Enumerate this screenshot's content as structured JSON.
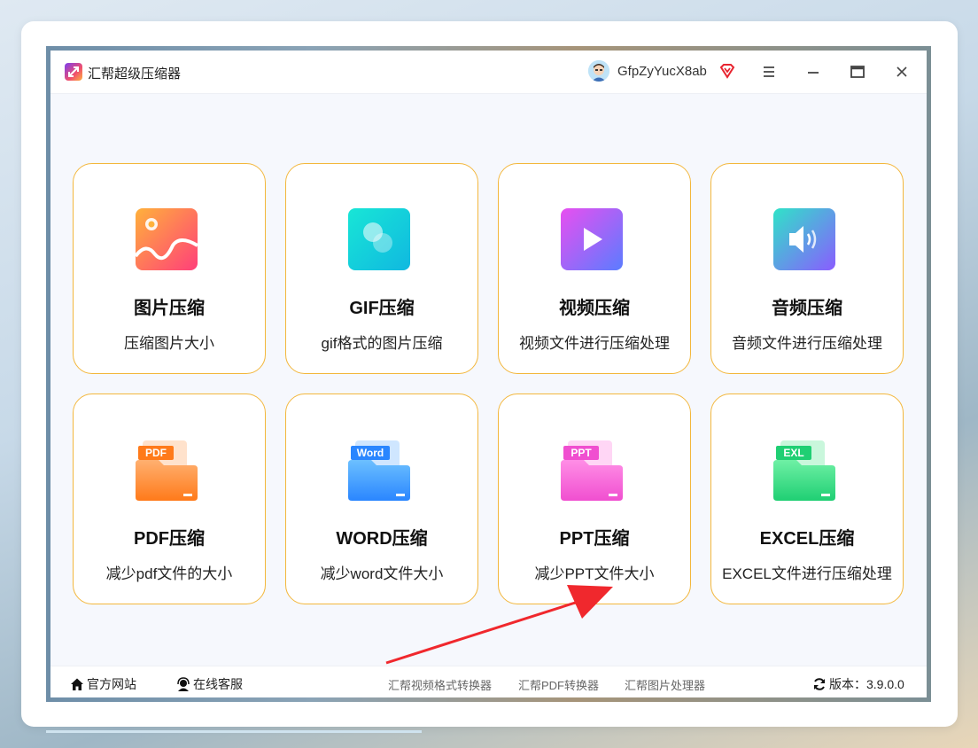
{
  "app": {
    "title": "汇帮超级压缩器"
  },
  "user": {
    "name": "GfpZyYucX8ab"
  },
  "tiles": [
    {
      "title": "图片压缩",
      "desc": "压缩图片大小"
    },
    {
      "title": "GIF压缩",
      "desc": "gif格式的图片压缩"
    },
    {
      "title": "视频压缩",
      "desc": "视频文件进行压缩处理"
    },
    {
      "title": "音频压缩",
      "desc": "音频文件进行压缩处理"
    },
    {
      "title": "PDF压缩",
      "desc": "减少pdf文件的大小",
      "badge": "PDF"
    },
    {
      "title": "WORD压缩",
      "desc": "减少word文件大小",
      "badge": "Word"
    },
    {
      "title": "PPT压缩",
      "desc": "减少PPT文件大小",
      "badge": "PPT"
    },
    {
      "title": "EXCEL压缩",
      "desc": "EXCEL文件进行压缩处理",
      "badge": "EXL"
    }
  ],
  "footer": {
    "website": "官方网站",
    "support": "在线客服",
    "links": [
      "汇帮视频格式转换器",
      "汇帮PDF转换器",
      "汇帮图片处理器"
    ],
    "version": "版本：3.9.0.0"
  },
  "colors": {
    "tile_border": "#f3b73c",
    "annotation_arrow": "#f0282d"
  }
}
